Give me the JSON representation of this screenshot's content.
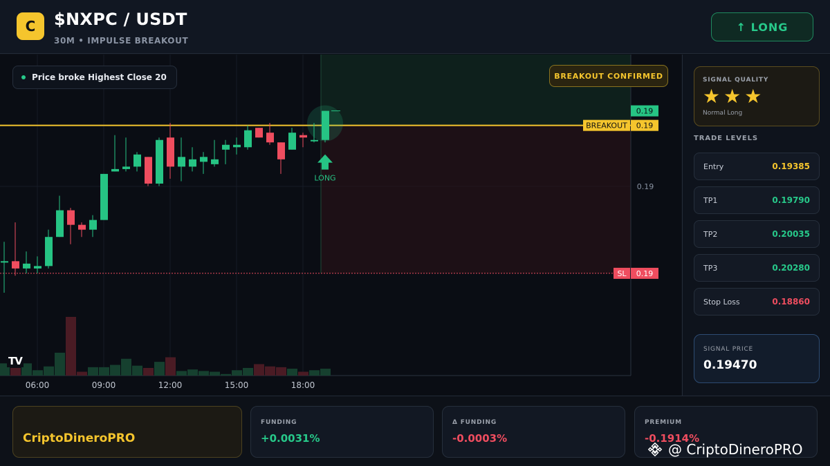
{
  "header": {
    "logo_letter": "C",
    "pair": "$NXPC / USDT",
    "subtitle": "30M • IMPULSE BREAKOUT",
    "signal_button": "↑ LONG"
  },
  "chart": {
    "status_text": "Price broke Highest Close 20",
    "confirm_badge": "BREAKOUT CONFIRMED",
    "tv_logo": "TV",
    "breakout_label": "BREAKOUT",
    "breakout_price": "0.19",
    "sl_label": "SL",
    "sl_price": "0.19",
    "current_price": "0.19",
    "axis_price": "0.19",
    "long_marker": "LONG",
    "x_ticks": [
      "06:00",
      "09:00",
      "12:00",
      "15:00",
      "18:00"
    ],
    "colors": {
      "up": "#26c484",
      "down": "#ef4d5f",
      "breakout": "#f5c52d",
      "sl": "#ef4d5f"
    }
  },
  "chart_data": {
    "type": "candlestick",
    "interval": "30m",
    "x": [
      "04:30",
      "05:00",
      "05:30",
      "06:00",
      "06:30",
      "07:00",
      "07:30",
      "08:00",
      "08:30",
      "09:00",
      "09:30",
      "10:00",
      "10:30",
      "11:00",
      "11:30",
      "12:00",
      "12:30",
      "13:00",
      "13:30",
      "14:00",
      "14:30",
      "15:00",
      "15:30",
      "16:00",
      "16:30",
      "17:00",
      "17:30",
      "18:00",
      "18:30",
      "19:00"
    ],
    "candles": [
      {
        "o": 0.1891,
        "h": 0.1899,
        "l": 0.1878,
        "c": 0.1891,
        "v": 16
      },
      {
        "o": 0.1891,
        "h": 0.1907,
        "l": 0.1885,
        "c": 0.1888,
        "v": 10
      },
      {
        "o": 0.1888,
        "h": 0.1895,
        "l": 0.1886,
        "c": 0.189,
        "v": 16
      },
      {
        "o": 0.1888,
        "h": 0.1893,
        "l": 0.1886,
        "c": 0.1889,
        "v": 7
      },
      {
        "o": 0.1889,
        "h": 0.1904,
        "l": 0.1888,
        "c": 0.1901,
        "v": 12
      },
      {
        "o": 0.1901,
        "h": 0.1918,
        "l": 0.1901,
        "c": 0.1912,
        "v": 30
      },
      {
        "o": 0.1912,
        "h": 0.1913,
        "l": 0.1898,
        "c": 0.1906,
        "v": 77
      },
      {
        "o": 0.1906,
        "h": 0.1907,
        "l": 0.1901,
        "c": 0.1904,
        "v": 5
      },
      {
        "o": 0.1904,
        "h": 0.191,
        "l": 0.1901,
        "c": 0.1908,
        "v": 11
      },
      {
        "o": 0.1908,
        "h": 0.1927,
        "l": 0.1908,
        "c": 0.1927,
        "v": 11
      },
      {
        "o": 0.1928,
        "h": 0.1943,
        "l": 0.1928,
        "c": 0.1929,
        "v": 14
      },
      {
        "o": 0.1929,
        "h": 0.1942,
        "l": 0.1928,
        "c": 0.193,
        "v": 22
      },
      {
        "o": 0.193,
        "h": 0.1936,
        "l": 0.1928,
        "c": 0.1935,
        "v": 13
      },
      {
        "o": 0.1934,
        "h": 0.1934,
        "l": 0.1922,
        "c": 0.1923,
        "v": 10
      },
      {
        "o": 0.1923,
        "h": 0.1942,
        "l": 0.1922,
        "c": 0.1941,
        "v": 18
      },
      {
        "o": 0.1942,
        "h": 0.1948,
        "l": 0.1925,
        "c": 0.193,
        "v": 24
      },
      {
        "o": 0.193,
        "h": 0.1942,
        "l": 0.1924,
        "c": 0.1934,
        "v": 6
      },
      {
        "o": 0.193,
        "h": 0.1938,
        "l": 0.1928,
        "c": 0.1933,
        "v": 8
      },
      {
        "o": 0.1932,
        "h": 0.1936,
        "l": 0.1927,
        "c": 0.1934,
        "v": 6
      },
      {
        "o": 0.1931,
        "h": 0.1941,
        "l": 0.193,
        "c": 0.1933,
        "v": 5
      },
      {
        "o": 0.1937,
        "h": 0.1941,
        "l": 0.1931,
        "c": 0.1939,
        "v": 2
      },
      {
        "o": 0.1938,
        "h": 0.1942,
        "l": 0.1935,
        "c": 0.1939,
        "v": 7
      },
      {
        "o": 0.1938,
        "h": 0.1947,
        "l": 0.1937,
        "c": 0.1945,
        "v": 10
      },
      {
        "o": 0.1946,
        "h": 0.1946,
        "l": 0.1942,
        "c": 0.1942,
        "v": 15
      },
      {
        "o": 0.1944,
        "h": 0.1948,
        "l": 0.1939,
        "c": 0.194,
        "v": 12
      },
      {
        "o": 0.194,
        "h": 0.194,
        "l": 0.1927,
        "c": 0.1933,
        "v": 11
      },
      {
        "o": 0.1937,
        "h": 0.1946,
        "l": 0.1937,
        "c": 0.1944,
        "v": 9
      },
      {
        "o": 0.1943,
        "h": 0.1944,
        "l": 0.1938,
        "c": 0.1942,
        "v": 5
      },
      {
        "o": 0.1941,
        "h": 0.1948,
        "l": 0.194,
        "c": 0.1941,
        "v": 7
      },
      {
        "o": 0.1941,
        "h": 0.1953,
        "l": 0.194,
        "c": 0.1953,
        "v": 9
      }
    ],
    "levels": {
      "breakout": 0.1947,
      "stop_loss": 0.1886,
      "last": 0.1953
    },
    "ylim": [
      0.1878,
      0.196
    ]
  },
  "signal": {
    "quality_title": "SIGNAL QUALITY",
    "stars": "★★★",
    "rating": 3,
    "rating_max": 3,
    "quality_type": "Normal Long",
    "levels_title": "TRADE LEVELS",
    "levels": [
      {
        "label": "Entry",
        "value": "0.19385",
        "color": "#f5c52d"
      },
      {
        "label": "TP1",
        "value": "0.19790",
        "color": "#27c98a"
      },
      {
        "label": "TP2",
        "value": "0.20035",
        "color": "#27c98a"
      },
      {
        "label": "TP3",
        "value": "0.20280",
        "color": "#27c98a"
      },
      {
        "label": "Stop Loss",
        "value": "0.18860",
        "color": "#ef4d5f"
      }
    ],
    "price_title": "SIGNAL PRICE",
    "price": "0.19470"
  },
  "footer": {
    "brand": "CriptoDineroPRO",
    "funding_title": "FUNDING",
    "funding_value": "+0.0031%",
    "dfunding_title": "Δ FUNDING",
    "dfunding_value": "-0.0003%",
    "premium_title": "PREMIUM",
    "premium_value": "-0.1914%",
    "watermark": "@ CriptoDineroPRO"
  }
}
